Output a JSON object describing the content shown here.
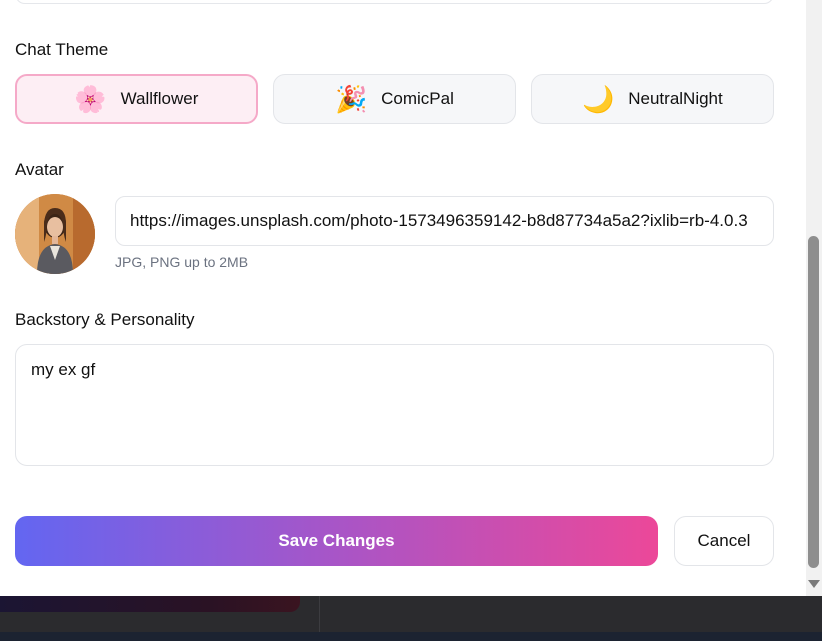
{
  "form": {
    "chat_theme_label": "Chat Theme",
    "themes": [
      {
        "emoji": "🌸",
        "icon": "cherry-blossom-icon",
        "label": "Wallflower",
        "selected": true
      },
      {
        "emoji": "🎉",
        "icon": "party-popper-icon",
        "label": "ComicPal",
        "selected": false
      },
      {
        "emoji": "🌙",
        "icon": "crescent-moon-icon",
        "label": "NeutralNight",
        "selected": false
      }
    ],
    "avatar_label": "Avatar",
    "avatar_url": "https://images.unsplash.com/photo-1573496359142-b8d87734a5a2?ixlib=rb-4.0.3",
    "avatar_hint": "JPG, PNG up to 2MB",
    "backstory_label": "Backstory & Personality",
    "backstory_value": "my ex gf",
    "save_label": "Save Changes",
    "cancel_label": "Cancel"
  },
  "colors": {
    "accent_gradient_start": "#6366f1",
    "accent_gradient_end": "#ec4899",
    "selected_border": "#f5a9c8",
    "selected_bg": "#fdeef4"
  }
}
